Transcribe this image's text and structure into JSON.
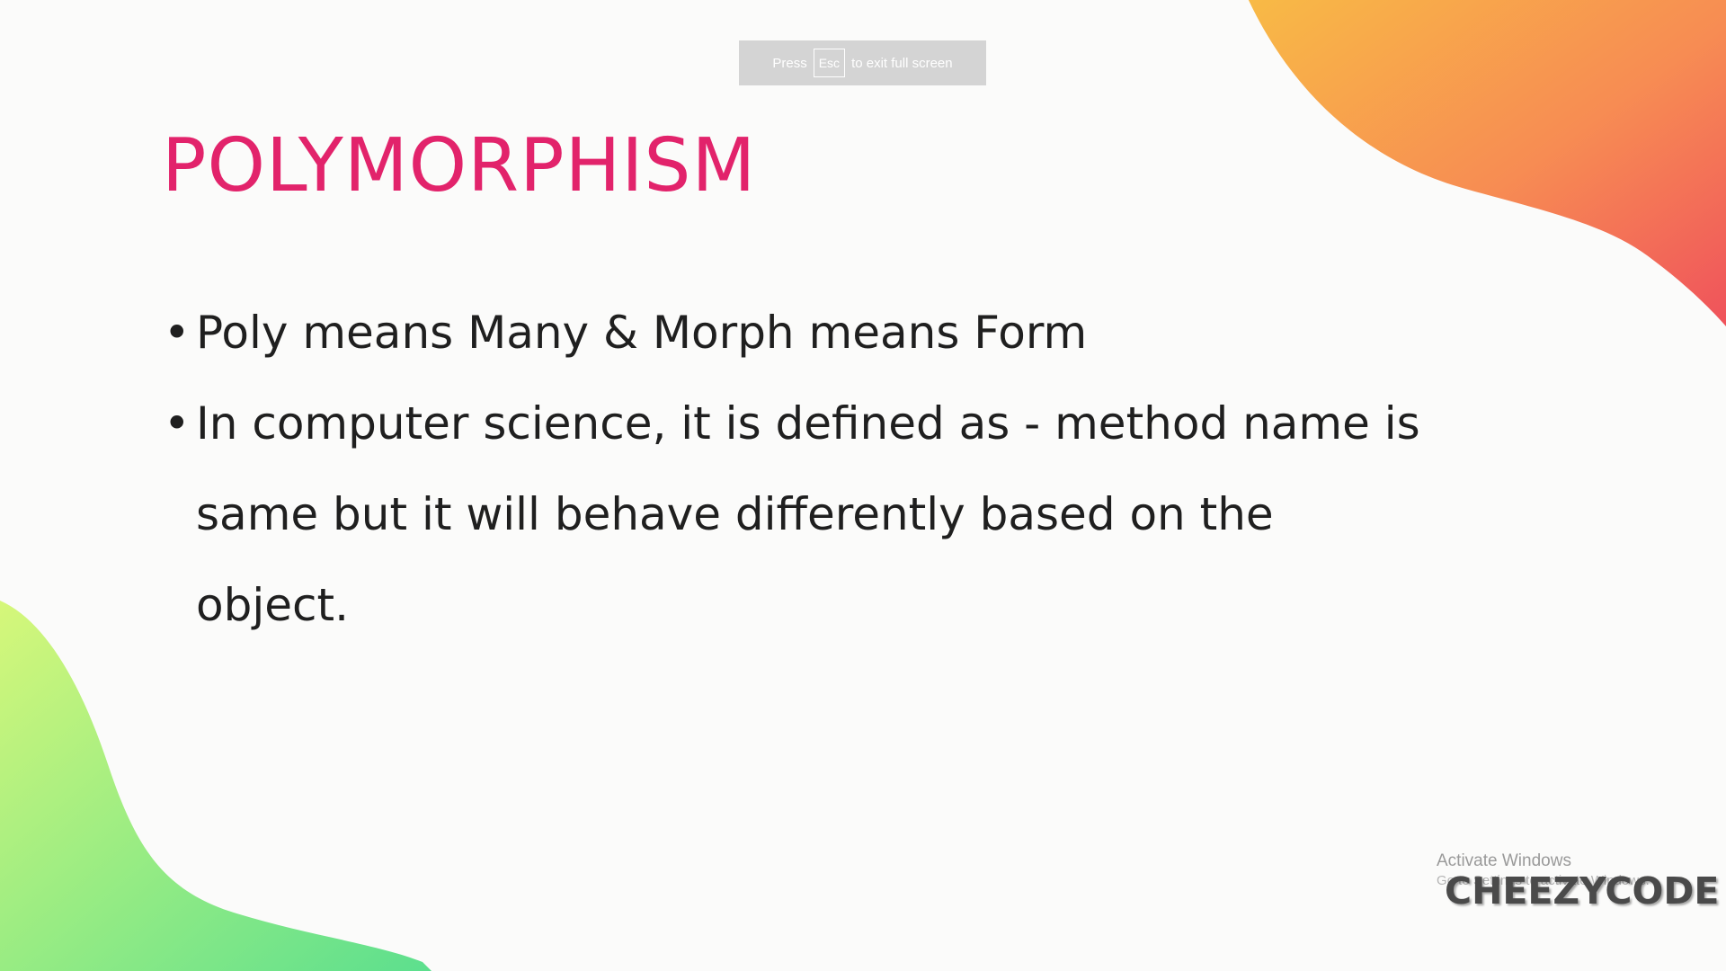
{
  "fullscreen_notice": {
    "prefix": "Press",
    "key": "Esc",
    "suffix": "to exit full screen"
  },
  "slide": {
    "title": "POLYMORPHISM",
    "bullets": [
      "Poly means Many & Morph means Form",
      "In computer science, it is defined as - method name is same but it will behave differently based on the object."
    ]
  },
  "watermark": {
    "activate_title": "Activate Windows",
    "activate_subtitle": "Go to Settings to activate Windows.",
    "brand": "CHEEZYCODE"
  },
  "colors": {
    "title": "#e2236b",
    "background": "#fbfbfa",
    "blob_top_right_start": "#f7b446",
    "blob_top_right_end": "#f0545a",
    "blob_bottom_left_start": "#d2f57a",
    "blob_bottom_left_end": "#5fe08d"
  }
}
